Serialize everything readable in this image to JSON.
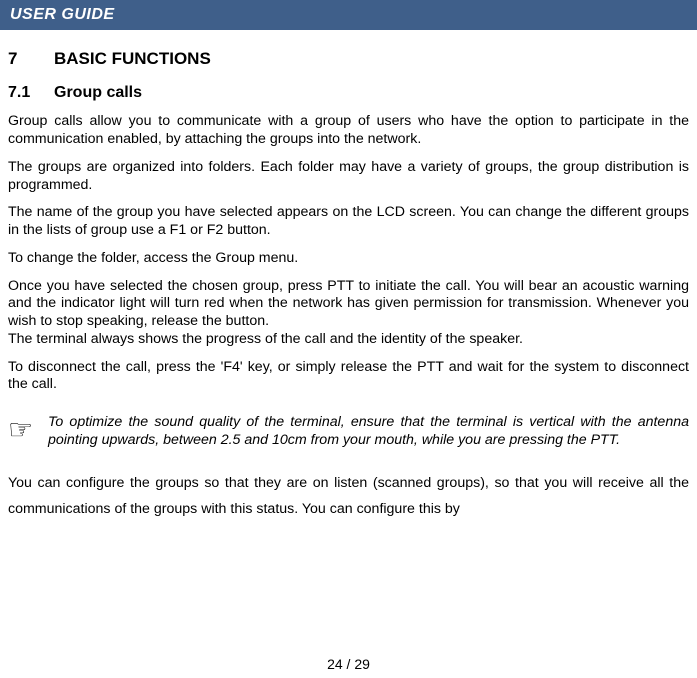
{
  "header": {
    "title": "USER GUIDE"
  },
  "section": {
    "num": "7",
    "title": "BASIC FUNCTIONS"
  },
  "subsection": {
    "num": "7.1",
    "title": "Group calls"
  },
  "p1": "Group calls allow you to communicate with a group of users who have the option to participate in the communication enabled, by attaching the groups into the network.",
  "p2": "The groups are organized into folders. Each folder may have a variety of groups, the group distribution is programmed.",
  "p3": "The name of the group you have selected appears on the LCD screen. You can change the different groups in the lists of group use a F1 or F2 button.",
  "p4": "To change the folder, access the Group menu.",
  "p5a": "Once you have selected the chosen group, press PTT to initiate the call. You will bear an acoustic warning and the indicator light will turn red when the network has given permission for transmission. Whenever you wish to stop speaking, release the button.",
  "p5b": "The terminal always shows the progress of the call and the identity of the speaker.",
  "p6": "To disconnect the call, press the 'F4' key, or simply release the PTT and wait for the system to disconnect the call.",
  "tip": "To optimize the sound quality of the terminal, ensure that the terminal is vertical with the antenna pointing upwards, between 2.5 and 10cm from your mouth, while you are pressing the PTT.",
  "p7": "You can configure the groups so that they are on listen (scanned groups), so that you will receive all the communications of the groups with this status. You can configure this by",
  "pager": "24 / 29",
  "icons": {
    "pointer": "☞"
  }
}
